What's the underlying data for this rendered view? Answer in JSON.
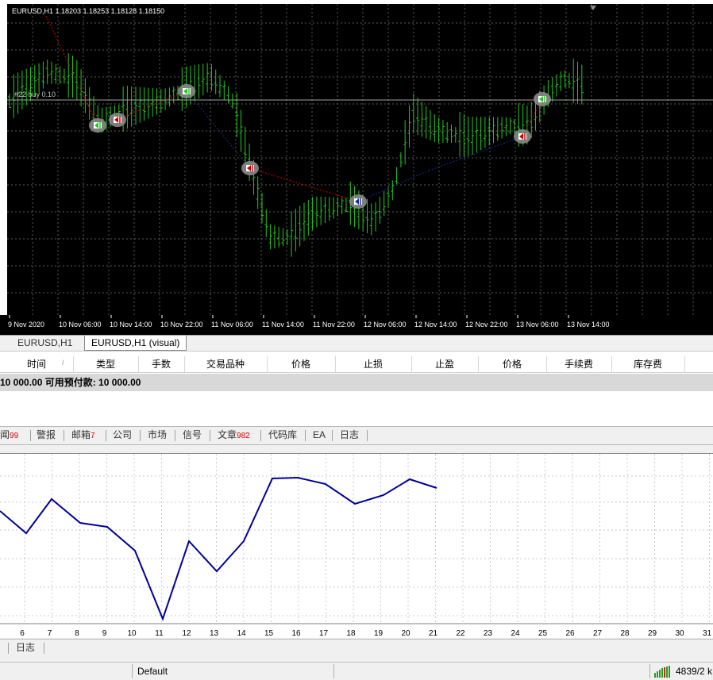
{
  "chart": {
    "info": "EURUSD,H1  1.18203 1.18253 1.18128 1.18150",
    "position_label": "#22 buy 0.10",
    "time_labels": [
      "9 Nov 2020",
      "10 Nov 06:00",
      "10 Nov 14:00",
      "10 Nov 22:00",
      "11 Nov 06:00",
      "11 Nov 14:00",
      "11 Nov 22:00",
      "12 Nov 06:00",
      "12 Nov 14:00",
      "12 Nov 22:00",
      "13 Nov 06:00",
      "13 Nov 14:00"
    ],
    "colors": {
      "background": "#000000",
      "grid": "#5a5a5a",
      "candle": "#22c822",
      "position_line": "#a0a0a0",
      "trade_win": "#cc0000",
      "trade_loss": "#1a2aa0"
    }
  },
  "chart_tabs": [
    "EURUSD,H1",
    "EURUSD,H1 (visual)"
  ],
  "terminal": {
    "columns": [
      "时间",
      "类型",
      "手数",
      "交易品种",
      "价格",
      "止损",
      "止盈",
      "价格",
      "手续费",
      "库存费"
    ],
    "balance_text": "10 000.00  可用预付款: 10 000.00"
  },
  "terminal_tabs": [
    {
      "label": "闻",
      "count": "99"
    },
    {
      "label": "警报",
      "count": ""
    },
    {
      "label": "邮箱",
      "count": "7"
    },
    {
      "label": "公司",
      "count": ""
    },
    {
      "label": "市场",
      "count": ""
    },
    {
      "label": "信号",
      "count": ""
    },
    {
      "label": "文章",
      "count": "982"
    },
    {
      "label": "代码库",
      "count": ""
    },
    {
      "label": "EA",
      "count": ""
    },
    {
      "label": "日志",
      "count": ""
    }
  ],
  "graph": {
    "x_labels": [
      "6",
      "7",
      "8",
      "9",
      "10",
      "11",
      "12",
      "13",
      "14",
      "15",
      "16",
      "17",
      "18",
      "19",
      "20",
      "21",
      "22",
      "23",
      "24",
      "25",
      "26",
      "27",
      "28",
      "29",
      "30",
      "31"
    ],
    "line_color": "#000099"
  },
  "graph_tabs": [
    "日志"
  ],
  "status": {
    "profile": "Default",
    "traffic": "4839/2 k"
  }
}
